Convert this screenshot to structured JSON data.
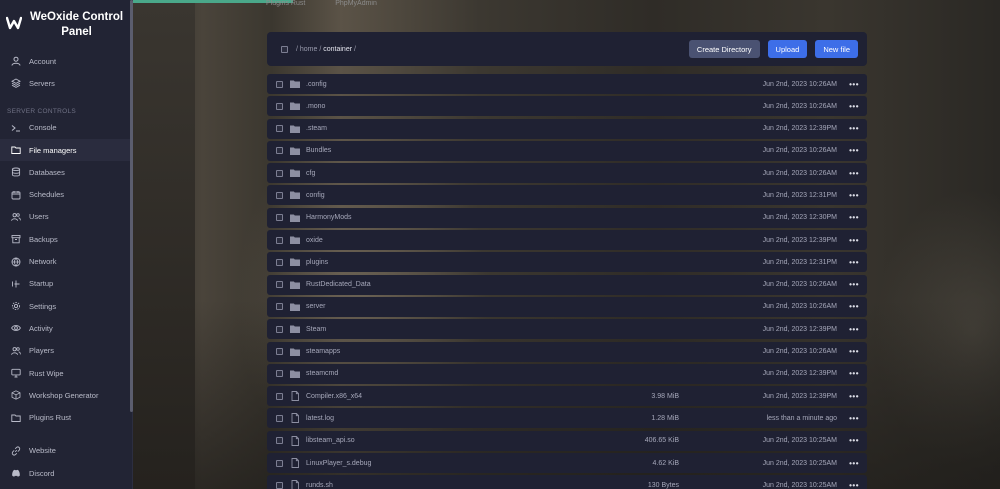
{
  "brand": {
    "title_line1": "WeOxide Control",
    "title_line2": "Panel"
  },
  "top_links": [
    "Plugins Rust",
    "PhpMyAdmin"
  ],
  "sidebar": {
    "top_items": [
      {
        "label": "Account",
        "icon": "user-icon"
      },
      {
        "label": "Servers",
        "icon": "layers-icon"
      }
    ],
    "section_label": "SERVER CONTROLS",
    "items": [
      {
        "label": "Console",
        "icon": "terminal-icon"
      },
      {
        "label": "File managers",
        "icon": "folder-icon",
        "active": true
      },
      {
        "label": "Databases",
        "icon": "database-icon"
      },
      {
        "label": "Schedules",
        "icon": "calendar-icon"
      },
      {
        "label": "Users",
        "icon": "users-icon"
      },
      {
        "label": "Backups",
        "icon": "archive-icon"
      },
      {
        "label": "Network",
        "icon": "globe-icon"
      },
      {
        "label": "Startup",
        "icon": "play-icon"
      },
      {
        "label": "Settings",
        "icon": "gear-icon"
      },
      {
        "label": "Activity",
        "icon": "eye-icon"
      },
      {
        "label": "Players",
        "icon": "users-icon"
      },
      {
        "label": "Rust Wipe",
        "icon": "monitor-icon"
      },
      {
        "label": "Workshop Generator",
        "icon": "package-icon"
      },
      {
        "label": "Plugins Rust",
        "icon": "folder-icon"
      }
    ],
    "bottom_items": [
      {
        "label": "Website",
        "icon": "link-icon"
      },
      {
        "label": "Discord",
        "icon": "discord-icon"
      }
    ]
  },
  "path": {
    "root": "/ home /",
    "current": "container",
    "trail": "/"
  },
  "toolbar": {
    "create_directory": "Create Directory",
    "upload": "Upload",
    "new_file": "New file"
  },
  "files": [
    {
      "name": ".config",
      "type": "folder",
      "size": "",
      "date": "Jun 2nd, 2023 10:26AM"
    },
    {
      "name": ".mono",
      "type": "folder",
      "size": "",
      "date": "Jun 2nd, 2023 10:26AM"
    },
    {
      "name": ".steam",
      "type": "folder",
      "size": "",
      "date": "Jun 2nd, 2023 12:39PM"
    },
    {
      "name": "Bundles",
      "type": "folder",
      "size": "",
      "date": "Jun 2nd, 2023 10:26AM"
    },
    {
      "name": "cfg",
      "type": "folder",
      "size": "",
      "date": "Jun 2nd, 2023 10:26AM"
    },
    {
      "name": "config",
      "type": "folder",
      "size": "",
      "date": "Jun 2nd, 2023 12:31PM"
    },
    {
      "name": "HarmonyMods",
      "type": "folder",
      "size": "",
      "date": "Jun 2nd, 2023 12:30PM"
    },
    {
      "name": "oxide",
      "type": "folder",
      "size": "",
      "date": "Jun 2nd, 2023 12:39PM"
    },
    {
      "name": "plugins",
      "type": "folder",
      "size": "",
      "date": "Jun 2nd, 2023 12:31PM"
    },
    {
      "name": "RustDedicated_Data",
      "type": "folder",
      "size": "",
      "date": "Jun 2nd, 2023 10:26AM"
    },
    {
      "name": "server",
      "type": "folder",
      "size": "",
      "date": "Jun 2nd, 2023 10:26AM"
    },
    {
      "name": "Steam",
      "type": "folder",
      "size": "",
      "date": "Jun 2nd, 2023 12:39PM"
    },
    {
      "name": "steamapps",
      "type": "folder",
      "size": "",
      "date": "Jun 2nd, 2023 10:26AM"
    },
    {
      "name": "steamcmd",
      "type": "folder",
      "size": "",
      "date": "Jun 2nd, 2023 12:39PM"
    },
    {
      "name": "Compiler.x86_x64",
      "type": "file",
      "size": "3.98 MiB",
      "date": "Jun 2nd, 2023 12:39PM"
    },
    {
      "name": "latest.log",
      "type": "file",
      "size": "1.28 MiB",
      "date": "less than a minute ago"
    },
    {
      "name": "libsteam_api.so",
      "type": "file",
      "size": "406.65 KiB",
      "date": "Jun 2nd, 2023 10:25AM"
    },
    {
      "name": "LinuxPlayer_s.debug",
      "type": "file",
      "size": "4.62 KiB",
      "date": "Jun 2nd, 2023 10:25AM"
    },
    {
      "name": "runds.sh",
      "type": "file",
      "size": "130 Bytes",
      "date": "Jun 2nd, 2023 10:25AM"
    }
  ],
  "row_menu_glyph": "•••",
  "colors": {
    "sidebar_bg": "#222434",
    "panel_bg": "#1f2133",
    "primary": "#3d6ee8",
    "secondary": "#4a5272"
  }
}
